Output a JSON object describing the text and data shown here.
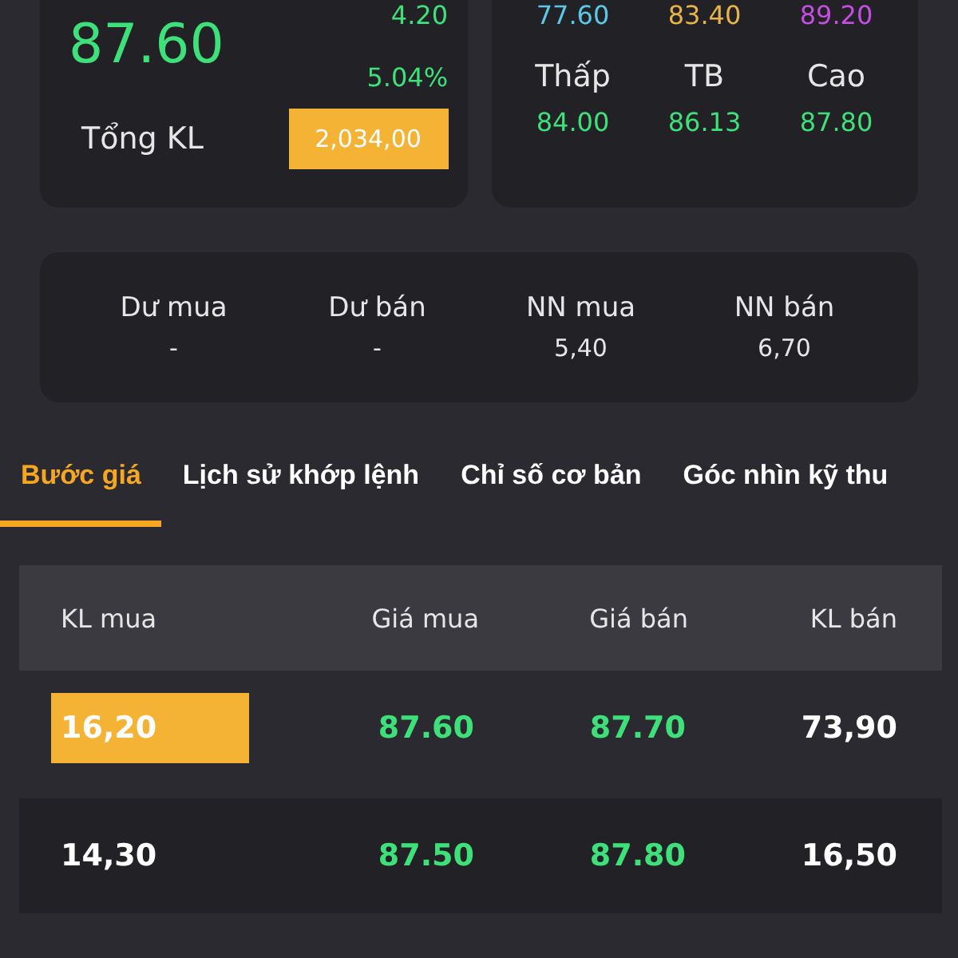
{
  "summary": {
    "price": "87.60",
    "change": "4.20",
    "percent": "5.04%",
    "volume_label": "Tổng KL",
    "volume": "2,034,00"
  },
  "price_range": {
    "top_values": [
      {
        "value": "77.60",
        "color": "#5bc8e8"
      },
      {
        "value": "83.40",
        "color": "#e8b44a"
      },
      {
        "value": "89.20",
        "color": "#c44ee0"
      }
    ],
    "stats": [
      {
        "label": "Thấp",
        "value": "84.00"
      },
      {
        "label": "TB",
        "value": "86.13"
      },
      {
        "label": "Cao",
        "value": "87.80"
      }
    ]
  },
  "flows": [
    {
      "label": "Dư mua",
      "value": "-"
    },
    {
      "label": "Dư bán",
      "value": "-"
    },
    {
      "label": "NN mua",
      "value": "5,40"
    },
    {
      "label": "NN bán",
      "value": "6,70"
    }
  ],
  "tabs": [
    {
      "label": "Bước giá",
      "selected": true
    },
    {
      "label": "Lịch sử khớp lệnh",
      "selected": false
    },
    {
      "label": "Chỉ số cơ bản",
      "selected": false
    },
    {
      "label": "Góc nhìn kỹ thu",
      "selected": false
    }
  ],
  "table": {
    "columns": [
      "KL mua",
      "Giá mua",
      "Giá bán",
      "KL bán"
    ],
    "rows": [
      {
        "buy_volume": "16,20",
        "buy_price": "87.60",
        "sell_price": "87.70",
        "sell_volume": "73,90",
        "highlighted": true
      },
      {
        "buy_volume": "14,30",
        "buy_price": "87.50",
        "sell_price": "87.80",
        "sell_volume": "16,50",
        "highlighted": false
      }
    ]
  }
}
